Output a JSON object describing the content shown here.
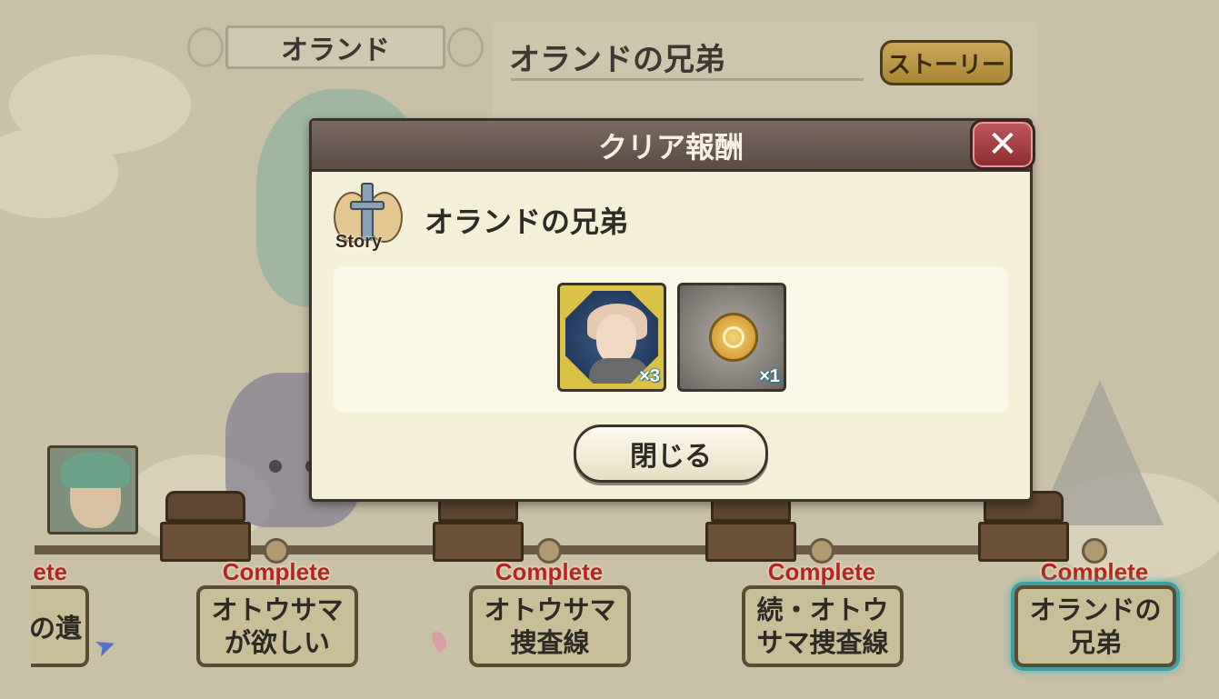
{
  "background": {
    "character_name": "オランド",
    "quest_title": "オランドの兄弟",
    "story_button_label": "ストーリー",
    "stages": [
      {
        "status": "Complete",
        "title": "オトウサマが欲しい"
      },
      {
        "status": "Complete",
        "title": "オトウサマ捜査線"
      },
      {
        "status": "Complete",
        "title": "続・オトウサマ捜査線"
      },
      {
        "status": "Complete",
        "title": "オランドの兄弟",
        "selected": true
      }
    ],
    "partial_stage": {
      "status": "ete",
      "title": "の遺"
    }
  },
  "modal": {
    "header": "クリア報酬",
    "close_icon": "close-x-icon",
    "emblem_label": "Story",
    "quest_title": "オランドの兄弟",
    "rewards": [
      {
        "type": "character",
        "icon": "character-portrait-icon",
        "quantity": "×3"
      },
      {
        "type": "coin",
        "icon": "gold-coin-icon",
        "quantity": "×1"
      }
    ],
    "close_button_label": "閉じる"
  },
  "colors": {
    "complete_red": "#b3232b",
    "modal_header": "#5a4c46",
    "close_red": "#8b2b30",
    "selected_cyan": "#3f9fa0"
  }
}
